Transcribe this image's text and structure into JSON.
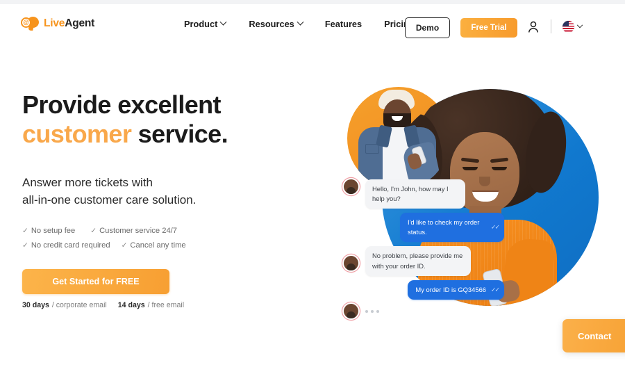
{
  "header": {
    "logo": {
      "mark_symbol": "@",
      "text_primary": "Live",
      "text_secondary": "Agent"
    },
    "nav": [
      {
        "label": "Product",
        "has_dropdown": true
      },
      {
        "label": "Resources",
        "has_dropdown": true
      },
      {
        "label": "Features",
        "has_dropdown": false
      },
      {
        "label": "Pricing",
        "has_dropdown": false
      }
    ],
    "demo_button": "Demo",
    "trial_button": "Free Trial",
    "account_icon": "person-icon",
    "language": {
      "flag": "us-flag",
      "chevron": "chevron-down-icon"
    }
  },
  "hero": {
    "headline_line1": "Provide excellent",
    "headline_accent": "customer",
    "headline_tail": " service.",
    "subhead_line1": "Answer more tickets with",
    "subhead_line2": "all-in-one customer care solution.",
    "perks": [
      "No setup fee",
      "Customer service 24/7",
      "No credit card required",
      "Cancel any time"
    ],
    "tick_glyph": "✓",
    "cta_button": "Get Started for FREE",
    "fineprint": {
      "days_30": "30 days",
      "corporate": "/ corporate email",
      "days_14": "14 days",
      "free": "/ free email"
    }
  },
  "chat": {
    "messages": [
      {
        "from": "agent",
        "text": "Hello, I'm John, how may I help you?",
        "read": false
      },
      {
        "from": "user",
        "text": "I'd like to check my order status.",
        "read": true
      },
      {
        "from": "agent",
        "text": "No problem, please provide me with your order ID.",
        "read": false
      },
      {
        "from": "user",
        "text": "My order ID is GQ34566",
        "read": true
      }
    ],
    "read_glyph": "✓✓",
    "typing_indicator": true
  },
  "contact_widget": {
    "label": "Contact"
  },
  "colors": {
    "brand_orange": "#f7941d",
    "accent_orange": "#f9a84b",
    "cta_gradient_start": "#fcb44a",
    "cta_gradient_end": "#f79f32",
    "chat_blue": "#1f6fe0",
    "circle_blue": "#1179cf",
    "circle_orange": "#ef8a1d",
    "text_dark": "#1b1b1b",
    "text_muted": "#7d7d7d",
    "bubble_gray": "#f3f4f6"
  }
}
